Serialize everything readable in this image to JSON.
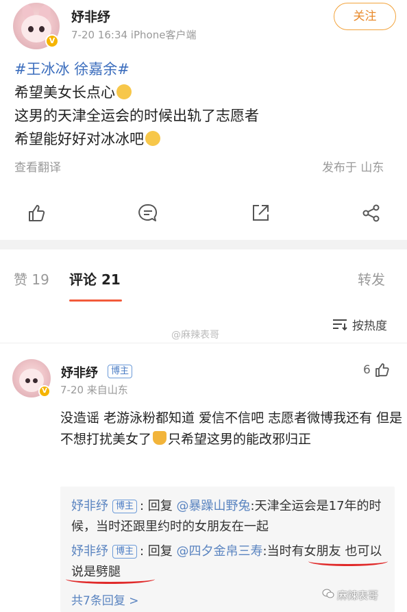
{
  "post": {
    "author": "妤非纾",
    "verified_badge": "V",
    "meta": "7-20 16:34  iPhone客户端",
    "follow_label": "关注",
    "topic": "#王冰冰 徐嘉余#",
    "lines": [
      "希望美女长点心",
      "这男的天津全运会的时候出轨了志愿者",
      "希望能好好对冰冰吧"
    ],
    "translate_label": "查看翻译",
    "location": "发布于 山东",
    "actions": [
      "like-icon",
      "comment-icon",
      "share-icon",
      "forward-icon"
    ]
  },
  "tabs": {
    "likes": "赞 19",
    "comments": "评论 21",
    "reposts": "转发"
  },
  "watermark_center": "@麻辣表哥",
  "sort": {
    "label": "按热度"
  },
  "comment": {
    "author": "妤非纾",
    "badge": "博主",
    "meta": "7-20   来自山东",
    "like_count": "6",
    "text_a": "没造谣 老游泳粉都知道 爱信不信吧 志愿者微博我还有 但是不想打扰美女了",
    "text_b": "只希望这男的能改邪归正",
    "replies": [
      {
        "name": "妤非纾",
        "badge": "博主",
        "prefix": ": 回复",
        "mention": "@暴躁山野兔",
        "text": ":天津全运会是17年的时候，当时还跟里约时的女朋友在一起"
      },
      {
        "name": "妤非纾",
        "badge": "博主",
        "prefix": ": 回复",
        "mention": "@四夕金帛三寿",
        "text": ":当时有女朋友 也可以说是劈腿"
      }
    ],
    "more_replies": "共7条回复 >"
  },
  "watermark_corner": "麻辣表哥",
  "colors": {
    "accent": "#f25a3b",
    "follow": "#e8892a",
    "link": "#5a84c0",
    "highlight": "#e02a2a"
  }
}
